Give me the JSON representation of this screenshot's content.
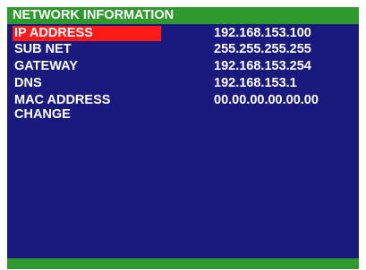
{
  "title": "NETWORK INFORMATION",
  "colors": {
    "background": "#1a1a7e",
    "title_bar": "#2e9a2e",
    "selection": "#ff1a1a",
    "text": "#ffffff"
  },
  "rows": [
    {
      "label": "IP ADDRESS",
      "value": "192.168.153.100",
      "selected": true
    },
    {
      "label": "SUB NET",
      "value": "255.255.255.255",
      "selected": false
    },
    {
      "label": "GATEWAY",
      "value": "192.168.153.254",
      "selected": false
    },
    {
      "label": "DNS",
      "value": "192.168.153.1",
      "selected": false
    },
    {
      "label": "MAC ADDRESS",
      "value": "00.00.00.00.00.00",
      "selected": false
    }
  ],
  "change_label": "CHANGE"
}
